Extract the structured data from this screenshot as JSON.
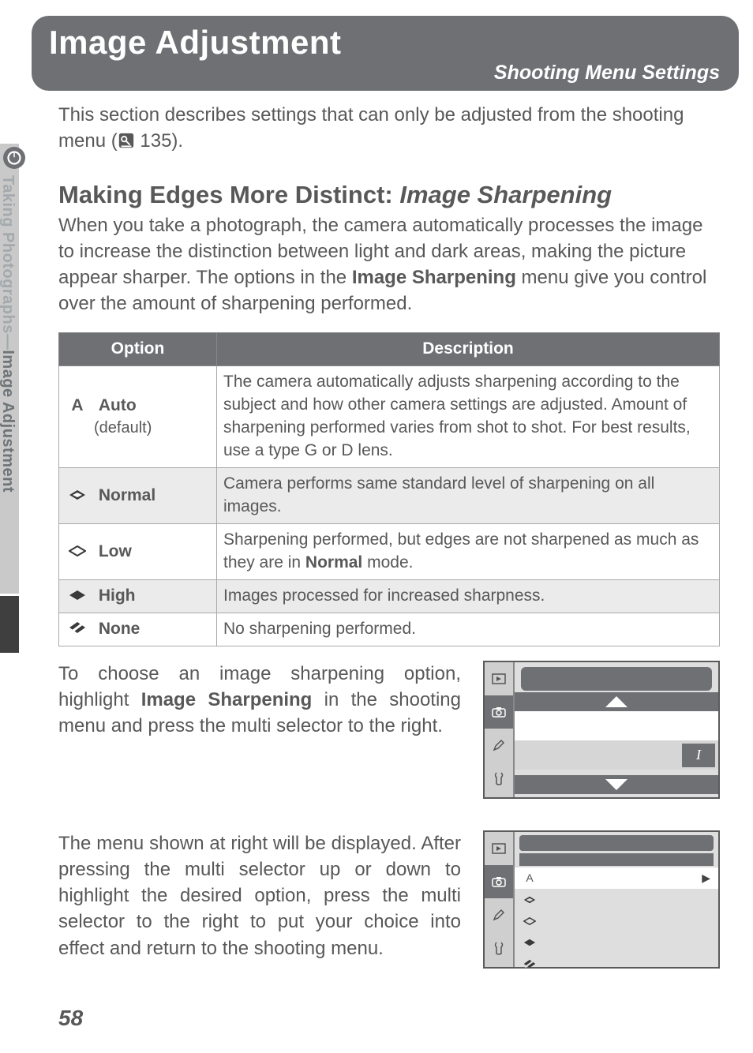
{
  "header": {
    "title": "Image Adjustment",
    "subtitle": "Shooting Menu Settings"
  },
  "sidebar": {
    "label_prefix": "Taking Photographs—",
    "label_suffix": "Image Adjustment"
  },
  "intro": {
    "text_before": "This section describes settings that can only be adjusted from the shooting menu (",
    "ref": "135",
    "text_after": ")."
  },
  "heading": {
    "plain": "Making Edges More Distinct: ",
    "italic": "Image Sharpening"
  },
  "body1": {
    "p1": "When you take a photograph, the camera automatically processes the image to increase the distinction between light and dark areas, making the picture appear sharper.  The options in the ",
    "bold": "Image Sharpening",
    "p2": " menu give you control over the amount of sharpening performed."
  },
  "table": {
    "headers": {
      "option": "Option",
      "description": "Description"
    },
    "rows": [
      {
        "icon": "A",
        "label": "Auto",
        "sublabel": "(default)",
        "desc": "The camera automatically adjusts sharpening according to the subject and how other camera settings are adjusted.  Amount of sharpening performed varies from shot to shot.  For best results, use a type G or D lens."
      },
      {
        "icon_svg": "diamond-filled",
        "label": "Normal",
        "desc": "Camera performs same standard level of sharpening on all images."
      },
      {
        "icon_svg": "diamond-outline",
        "label": "Low",
        "desc_before": "Sharpening performed, but edges are not sharpened as much as they are in ",
        "desc_bold": "Normal",
        "desc_after": " mode."
      },
      {
        "icon_svg": "diamond-solid",
        "label": "High",
        "desc": "Images processed for increased sharpness."
      },
      {
        "icon_svg": "no-symbol",
        "label": "None",
        "desc": "No sharpening performed."
      }
    ]
  },
  "para2": {
    "before": "To choose an image sharpening option, highlight ",
    "bold": "Image Sharpening",
    "after": " in the shooting menu and press the multi selector to the right."
  },
  "para3": "The menu shown at right will be displayed.  After pressing the multi selector up or down to highlight the desired option, press the multi selector to the right to put your choice into effect and return to the shooting menu.",
  "menu1_indicator": "I",
  "menu2": {
    "options": [
      "A",
      "diamond-filled",
      "diamond-outline",
      "diamond-solid",
      "no-symbol"
    ]
  },
  "page_number": "58"
}
